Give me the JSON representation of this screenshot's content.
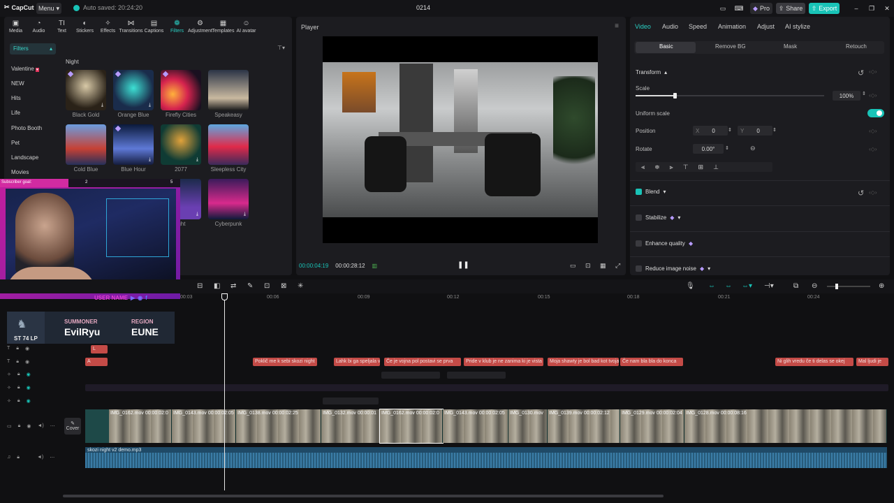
{
  "app": {
    "logo": "CapCut",
    "menu_label": "Menu",
    "autosave": "Auto saved: 20:24:20",
    "project_title": "0214"
  },
  "topbar": {
    "pro_label": "Pro",
    "share_label": "Share",
    "export_label": "Export"
  },
  "toolbar": [
    {
      "label": "Media",
      "icon": "media-icon"
    },
    {
      "label": "Audio",
      "icon": "audio-icon"
    },
    {
      "label": "Text",
      "icon": "text-icon"
    },
    {
      "label": "Stickers",
      "icon": "sticker-icon"
    },
    {
      "label": "Effects",
      "icon": "effects-icon"
    },
    {
      "label": "Transitions",
      "icon": "transitions-icon"
    },
    {
      "label": "Captions",
      "icon": "captions-icon"
    },
    {
      "label": "Filters",
      "icon": "filters-icon"
    },
    {
      "label": "Adjustment",
      "icon": "adjustment-icon"
    },
    {
      "label": "Templates",
      "icon": "templates-icon"
    },
    {
      "label": "AI avatar",
      "icon": "ai-avatar-icon"
    }
  ],
  "filters": {
    "category_header": "Filters",
    "categories": [
      "Valentine",
      "NEW",
      "Hits",
      "Life",
      "Photo Booth",
      "Pet",
      "Landscape",
      "Movies"
    ],
    "section": "Night",
    "items": [
      "Black Gold",
      "Orange Blue",
      "Firefly Cities",
      "Speakeasy",
      "Cold Blue",
      "Blue Hour",
      "2077",
      "Sleepless City",
      "ight",
      "Cyberpunk"
    ]
  },
  "overlay": {
    "goal_label": "Subscriber goal:",
    "goal_current": "2",
    "goal_target": "5",
    "username": "USER NAME",
    "lp": "74 LP",
    "rank_prefix": "ST",
    "summoner_label": "SUMMONER",
    "summoner_value": "EvilRyu",
    "region_label": "REGION",
    "region_value": "EUNE"
  },
  "player": {
    "title": "Player",
    "current_time": "00:00:04:19",
    "total_time": "00:00:28:12"
  },
  "props": {
    "tabs": [
      "Video",
      "Audio",
      "Speed",
      "Animation",
      "Adjust",
      "AI stylize"
    ],
    "subtabs": [
      "Basic",
      "Remove BG",
      "Mask",
      "Retouch"
    ],
    "transform_label": "Transform",
    "scale_label": "Scale",
    "scale_value": "100%",
    "scale_fraction": 0.1,
    "uniform_scale_label": "Uniform scale",
    "position_label": "Position",
    "pos_x_label": "X",
    "pos_x": "0",
    "pos_y_label": "Y",
    "pos_y": "0",
    "rotate_label": "Rotate",
    "rotate_value": "0.00°",
    "blend_label": "Blend",
    "stabilize_label": "Stabilize",
    "enhance_label": "Enhance quality",
    "noise_label": "Reduce image noise"
  },
  "timeline": {
    "ruler": [
      "00:03",
      "00:06",
      "00:09",
      "00:12",
      "00:15",
      "00:18",
      "00:21",
      "00:24"
    ],
    "short_clips": [
      "L",
      "A"
    ],
    "captions": [
      "Poklič me k sebi skozi night",
      "Lahk bi ga speljala v",
      "Če je vojna pol postavi se prva",
      "Pride v klub je ne zanima ki je vista",
      "Moja shawty je bol bad kot tvoja",
      "Če nam bla bla do konca",
      "Ni glih vredu če ti delas se okej",
      "Mal ljudi je"
    ],
    "video_clips": [
      {
        "name": "IMG_0162.mov",
        "dur": "00:00:02:0"
      },
      {
        "name": "IMG_0143.mov",
        "dur": "00:00:02:05"
      },
      {
        "name": "IMG_0138.mov",
        "dur": "00:00:02:25"
      },
      {
        "name": "IMG_0132.mov",
        "dur": "00:00:01"
      },
      {
        "name": "IMG_0162.mov",
        "dur": "00:00:02:0"
      },
      {
        "name": "IMG_0143.mov",
        "dur": "00:00:02:05"
      },
      {
        "name": "IMG_0130.mov",
        "dur": ""
      },
      {
        "name": "IMG_0139.mov",
        "dur": "00:00:02:12"
      },
      {
        "name": "IMG_0129.mov",
        "dur": "00:00:02:04"
      },
      {
        "name": "IMG_0128.mov",
        "dur": "00:00:08:16"
      }
    ],
    "cover_label": "Cover",
    "audio_clip": "skozi night v2 demo.mp3"
  }
}
